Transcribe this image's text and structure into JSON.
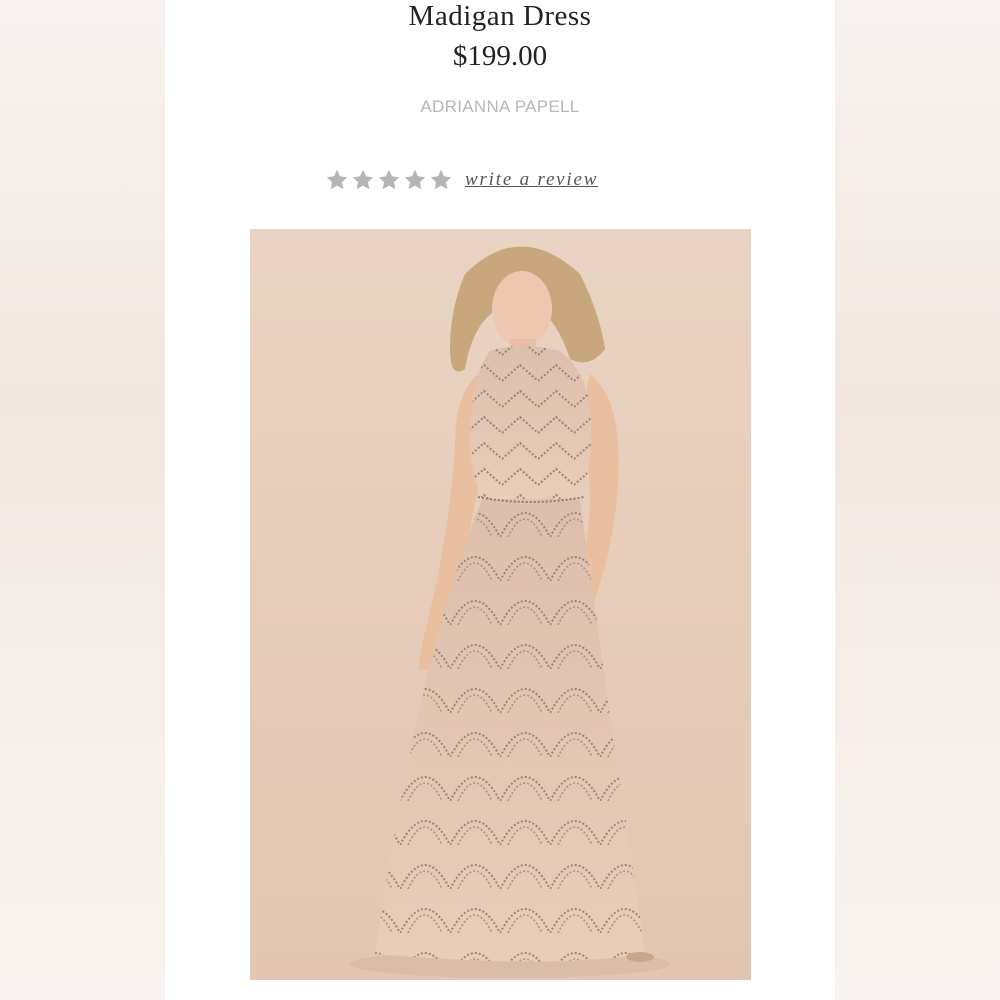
{
  "product": {
    "name": "Madigan Dress",
    "price": "$199.00",
    "brand": "ADRIANNA PAPELL"
  },
  "rating": {
    "stars": 5,
    "filled": 0,
    "review_link": "write a review"
  },
  "icons": {
    "star": "star-icon"
  },
  "colors": {
    "background": "#ecd5c3",
    "dress": "#e6c7b0",
    "beading": "#8a7a70",
    "star_empty": "#b5b5b5",
    "text": "#222222",
    "brand_text": "#b7b7b7"
  }
}
